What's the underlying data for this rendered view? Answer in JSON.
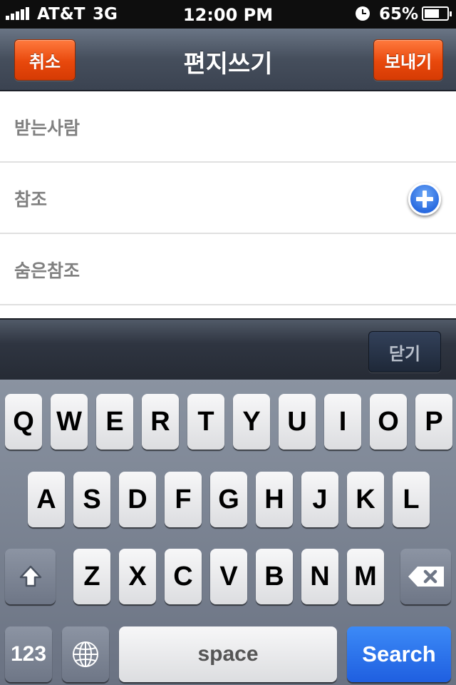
{
  "status_bar": {
    "carrier": "AT&T",
    "network": "3G",
    "time": "12:00 PM",
    "battery_percent": "65%",
    "battery_level": 0.65
  },
  "nav": {
    "cancel_label": "취소",
    "title": "편지쓰기",
    "send_label": "보내기"
  },
  "form": {
    "to_label": "받는사람",
    "cc_label": "참조",
    "bcc_label": "숨은참조"
  },
  "accessory": {
    "close_label": "닫기"
  },
  "keyboard": {
    "row1": [
      "Q",
      "W",
      "E",
      "R",
      "T",
      "Y",
      "U",
      "I",
      "O",
      "P"
    ],
    "row2": [
      "A",
      "S",
      "D",
      "F",
      "G",
      "H",
      "J",
      "K",
      "L"
    ],
    "row3": [
      "Z",
      "X",
      "C",
      "V",
      "B",
      "N",
      "M"
    ],
    "numbers_label": "123",
    "space_label": "space",
    "search_label": "Search"
  },
  "colors": {
    "accent_orange": "#e8480c",
    "search_blue": "#1f5fe0",
    "plus_blue": "#2a6be0"
  },
  "icons": {
    "shift": "shift-icon",
    "backspace": "backspace-icon",
    "globe": "globe-icon",
    "add_cc": "plus-circle-icon",
    "alarm": "alarm-clock-icon",
    "battery": "battery-icon"
  }
}
